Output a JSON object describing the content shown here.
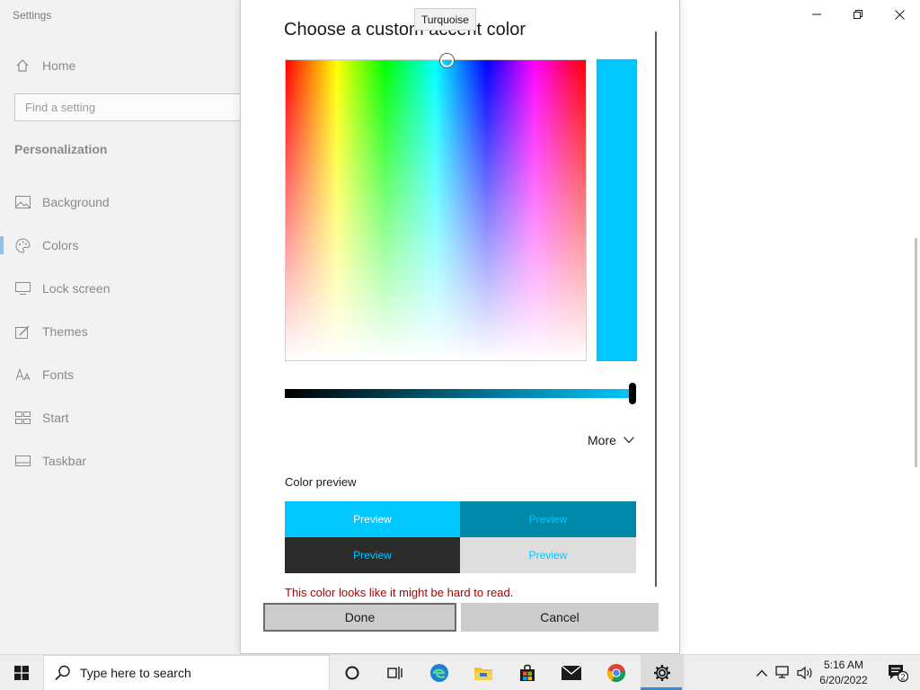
{
  "settings": {
    "app_title": "Settings",
    "home_label": "Home",
    "search_placeholder": "Find a setting",
    "section_title": "Personalization",
    "nav": [
      {
        "label": "Background",
        "icon": "image-icon"
      },
      {
        "label": "Colors",
        "icon": "palette-icon"
      },
      {
        "label": "Lock screen",
        "icon": "monitor-icon"
      },
      {
        "label": "Themes",
        "icon": "brush-icon"
      },
      {
        "label": "Fonts",
        "icon": "font-icon"
      },
      {
        "label": "Start",
        "icon": "start-layout-icon"
      },
      {
        "label": "Taskbar",
        "icon": "taskbar-icon"
      }
    ],
    "selected_nav": "Colors",
    "window_controls": [
      "minimize-icon",
      "restore-icon",
      "close-icon"
    ]
  },
  "dialog": {
    "title": "Choose a custom accent color",
    "tooltip": "Turquoise",
    "selected_color": "#00c8ff",
    "value_level": 1.0,
    "more_label": "More",
    "preview_heading": "Color preview",
    "previews": [
      {
        "label": "Preview",
        "bg": "#00c8ff",
        "fg": "#ffffff"
      },
      {
        "label": "Preview",
        "bg": "#0088a8",
        "fg": "#00c8ff"
      },
      {
        "label": "Preview",
        "bg": "#2b2b2b",
        "fg": "#00c8ff"
      },
      {
        "label": "Preview",
        "bg": "#dedede",
        "fg": "#00c8ff"
      }
    ],
    "warning": "This color looks like it might be hard to read.",
    "done_label": "Done",
    "cancel_label": "Cancel"
  },
  "taskbar": {
    "search_placeholder": "Type here to search",
    "apps": [
      "cortana-icon",
      "task-view-icon",
      "edge-icon",
      "file-explorer-icon",
      "microsoft-store-icon",
      "mail-icon",
      "chrome-icon",
      "settings-gear-icon"
    ],
    "time": "5:16 AM",
    "date": "6/20/2022",
    "notification_count": "2"
  }
}
